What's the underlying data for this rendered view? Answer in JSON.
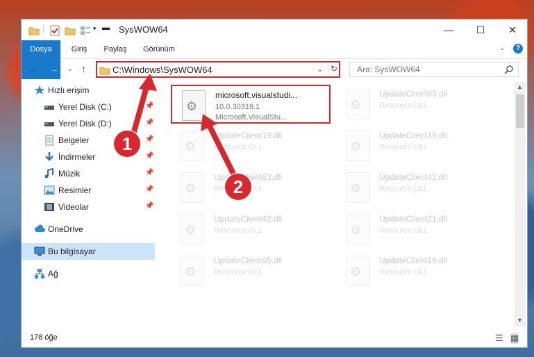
{
  "window": {
    "title": "SysWOW64"
  },
  "ribbon": {
    "tabs": [
      "Dosya",
      "Giriş",
      "Paylaş",
      "Görünüm"
    ]
  },
  "address": {
    "path": "C:\\Windows\\SysWOW64"
  },
  "search": {
    "placeholder": "Ara: SysWOW64"
  },
  "sidebar": {
    "items": [
      {
        "label": "Hızlı erişim",
        "icon": "star-icon"
      },
      {
        "label": "Yerel Disk (C:)",
        "icon": "drive-icon",
        "pinned": true
      },
      {
        "label": "Yerel Disk (D:)",
        "icon": "drive-icon",
        "pinned": true
      },
      {
        "label": "Belgeler",
        "icon": "documents-icon",
        "pinned": true
      },
      {
        "label": "İndirmeler",
        "icon": "download-icon",
        "pinned": true
      },
      {
        "label": "Müzik",
        "icon": "music-icon",
        "pinned": true
      },
      {
        "label": "Resimler",
        "icon": "pictures-icon",
        "pinned": true
      },
      {
        "label": "Videolar",
        "icon": "video-icon",
        "pinned": true
      },
      {
        "label": "OneDrive",
        "icon": "cloud-icon"
      },
      {
        "label": "Bu bilgisayar",
        "icon": "computer-icon",
        "selected": true
      },
      {
        "label": "Ağ",
        "icon": "network-icon"
      }
    ]
  },
  "files": [
    {
      "name": "microsoft.visualstudi...",
      "line2": "10.0.30319.1",
      "line3": "Microsoft.VisualStu...",
      "selected": true
    },
    {
      "name": "UpdateClient63.dll",
      "line2": "Resource DLL"
    },
    {
      "name": "UpdateClient19.dll",
      "line2": "Resource DLL"
    },
    {
      "name": "UpdateClient19.dll",
      "line2": "Resource DLL"
    },
    {
      "name": "UpdateClient63.dll",
      "line2": "Resource DLL"
    },
    {
      "name": "UpdateClient42.dll",
      "line2": "Resource DLL"
    },
    {
      "name": "UpdateClient42.dll",
      "line2": "Resource DLL"
    },
    {
      "name": "UpdateClient21.dll",
      "line2": "Resource DLL"
    },
    {
      "name": "UpdateClient65.dll",
      "line2": "Resource DLL"
    },
    {
      "name": "UpdateClient19.dll",
      "line2": "Resource DLL"
    }
  ],
  "status": {
    "count": "178 öğe"
  },
  "annotations": {
    "badge1": "1",
    "badge2": "2"
  },
  "colors": {
    "accent": "#1979ca",
    "highlight": "#d9272e"
  }
}
